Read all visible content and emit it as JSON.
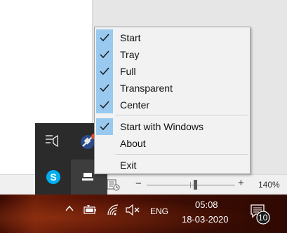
{
  "menu": {
    "items": [
      {
        "label": "Start",
        "checked": true
      },
      {
        "label": "Tray",
        "checked": true
      },
      {
        "label": "Full",
        "checked": true
      },
      {
        "label": "Transparent",
        "checked": true
      },
      {
        "label": "Center",
        "checked": true
      },
      {
        "label": "Start with Windows",
        "checked": true
      },
      {
        "label": "About",
        "checked": false
      },
      {
        "label": "Exit",
        "checked": false
      }
    ]
  },
  "statusbar": {
    "zoom": "140%",
    "zoom_minus": "−",
    "zoom_plus": "+"
  },
  "taskbar": {
    "chevron": "^",
    "language": "ENG",
    "time": "05:08",
    "date": "18-03-2020",
    "notification_count": "10"
  },
  "flyout": {
    "icons": [
      "taskview-list-icon",
      "satellite-app-icon",
      "skype-icon",
      "tray-app-icon"
    ]
  },
  "colors": {
    "check_highlight": "#99c9ef",
    "menu_bg": "#f2f2f2",
    "taskbar": "#4a1004",
    "flyout_bg": "#2b2b2b"
  }
}
